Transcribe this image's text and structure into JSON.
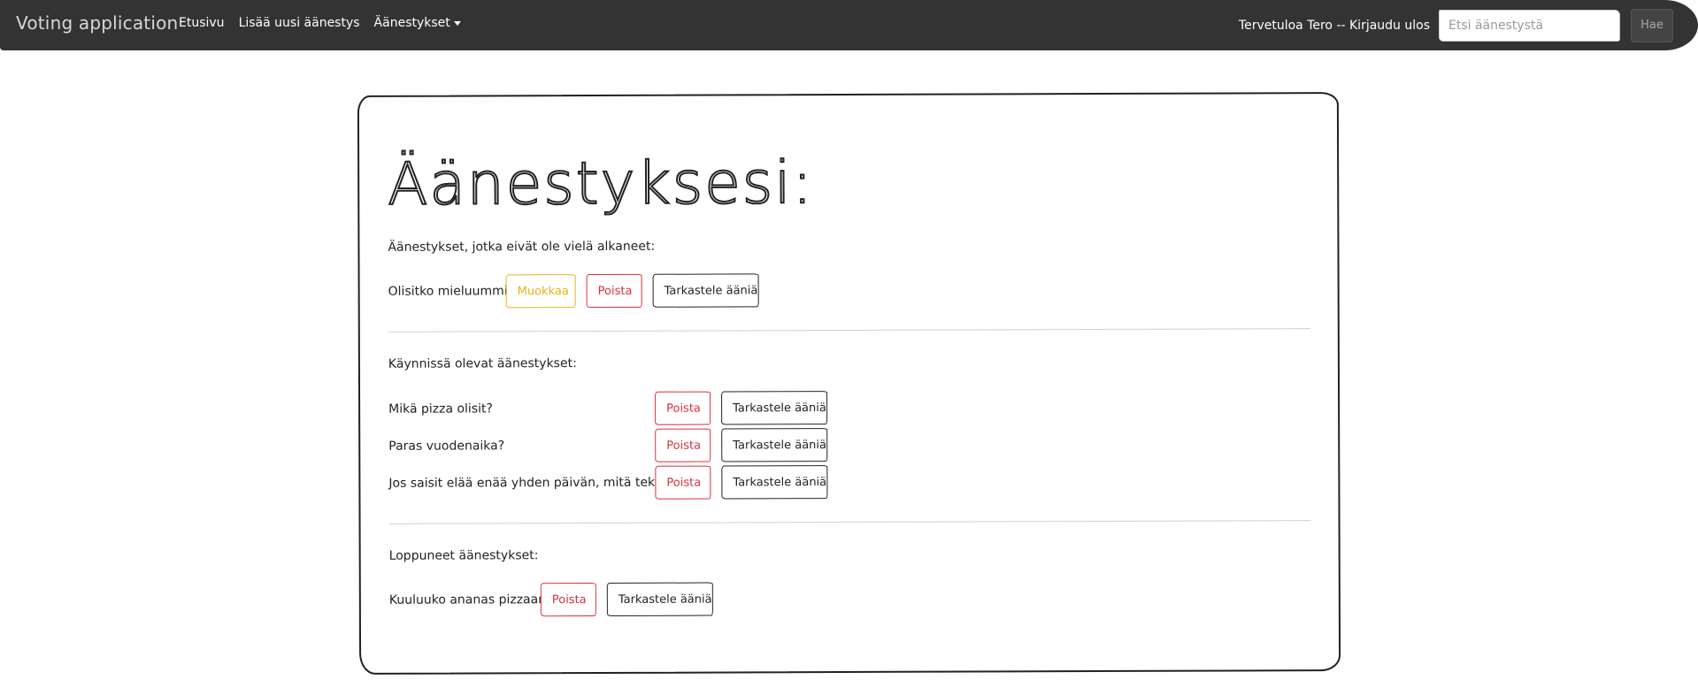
{
  "navbar": {
    "brand": "Voting application",
    "links": [
      "Etusivu",
      "Lisää uusi äänestys",
      "Äänestykset"
    ],
    "welcome": "Tervetuloa Tero -- Kirjaudu ulos",
    "search_placeholder": "Etsi äänestystä",
    "search_button": "Hae"
  },
  "main": {
    "title": "Äänestyksesi:",
    "sections": [
      {
        "label": "Äänestykset, jotka eivät ole vielä alkaneet:",
        "items": [
          {
            "name": "Olisitko mieluummin",
            "edit": "Muokkaa",
            "delete": "Poista",
            "view": "Tarkastele ääniä"
          }
        ]
      },
      {
        "label": "Käynnissä olevat äänestykset:",
        "items": [
          {
            "name": "Mikä pizza olisit?",
            "delete": "Poista",
            "view": "Tarkastele ääniä"
          },
          {
            "name": "Paras vuodenaika?",
            "delete": "Poista",
            "view": "Tarkastele ääniä"
          },
          {
            "name": "Jos saisit elää enää yhden päivän, mitä tekisit?",
            "delete": "Poista",
            "view": "Tarkastele ääniä"
          }
        ]
      },
      {
        "label": "Loppuneet äänestykset:",
        "items": [
          {
            "name": "Kuuluuko ananas pizzaan?",
            "delete": "Poista",
            "view": "Tarkastele ääniä"
          }
        ]
      }
    ]
  },
  "colors": {
    "navbar": "#333333",
    "warning": "#e8b21a",
    "danger": "#d9303e",
    "dark": "#222222"
  }
}
